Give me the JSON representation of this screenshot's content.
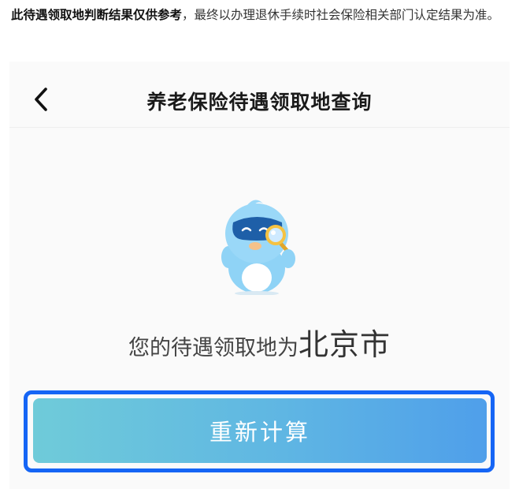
{
  "notice": {
    "bold_text": "此待遇领取地判断结果仅供参考",
    "rest_text": "，最终以办理退休手续时社会保险相关部门认定结果为准。"
  },
  "header": {
    "title": "养老保险待遇领取地查询",
    "back_icon": "chevron-left-icon"
  },
  "mascot": {
    "icon": "blue-mascot-with-magnifier-icon",
    "colors": {
      "body": "#8fd3f6",
      "visor": "#1e5fa8",
      "lens": "#f5c242"
    }
  },
  "result": {
    "prefix": "您的待遇领取地为",
    "city": "北京市"
  },
  "actions": {
    "recalculate_label": "重新计算"
  },
  "colors": {
    "button_gradient_start": "#6fcbd9",
    "button_gradient_end": "#4f9fea",
    "highlight_border": "#1565f5"
  }
}
